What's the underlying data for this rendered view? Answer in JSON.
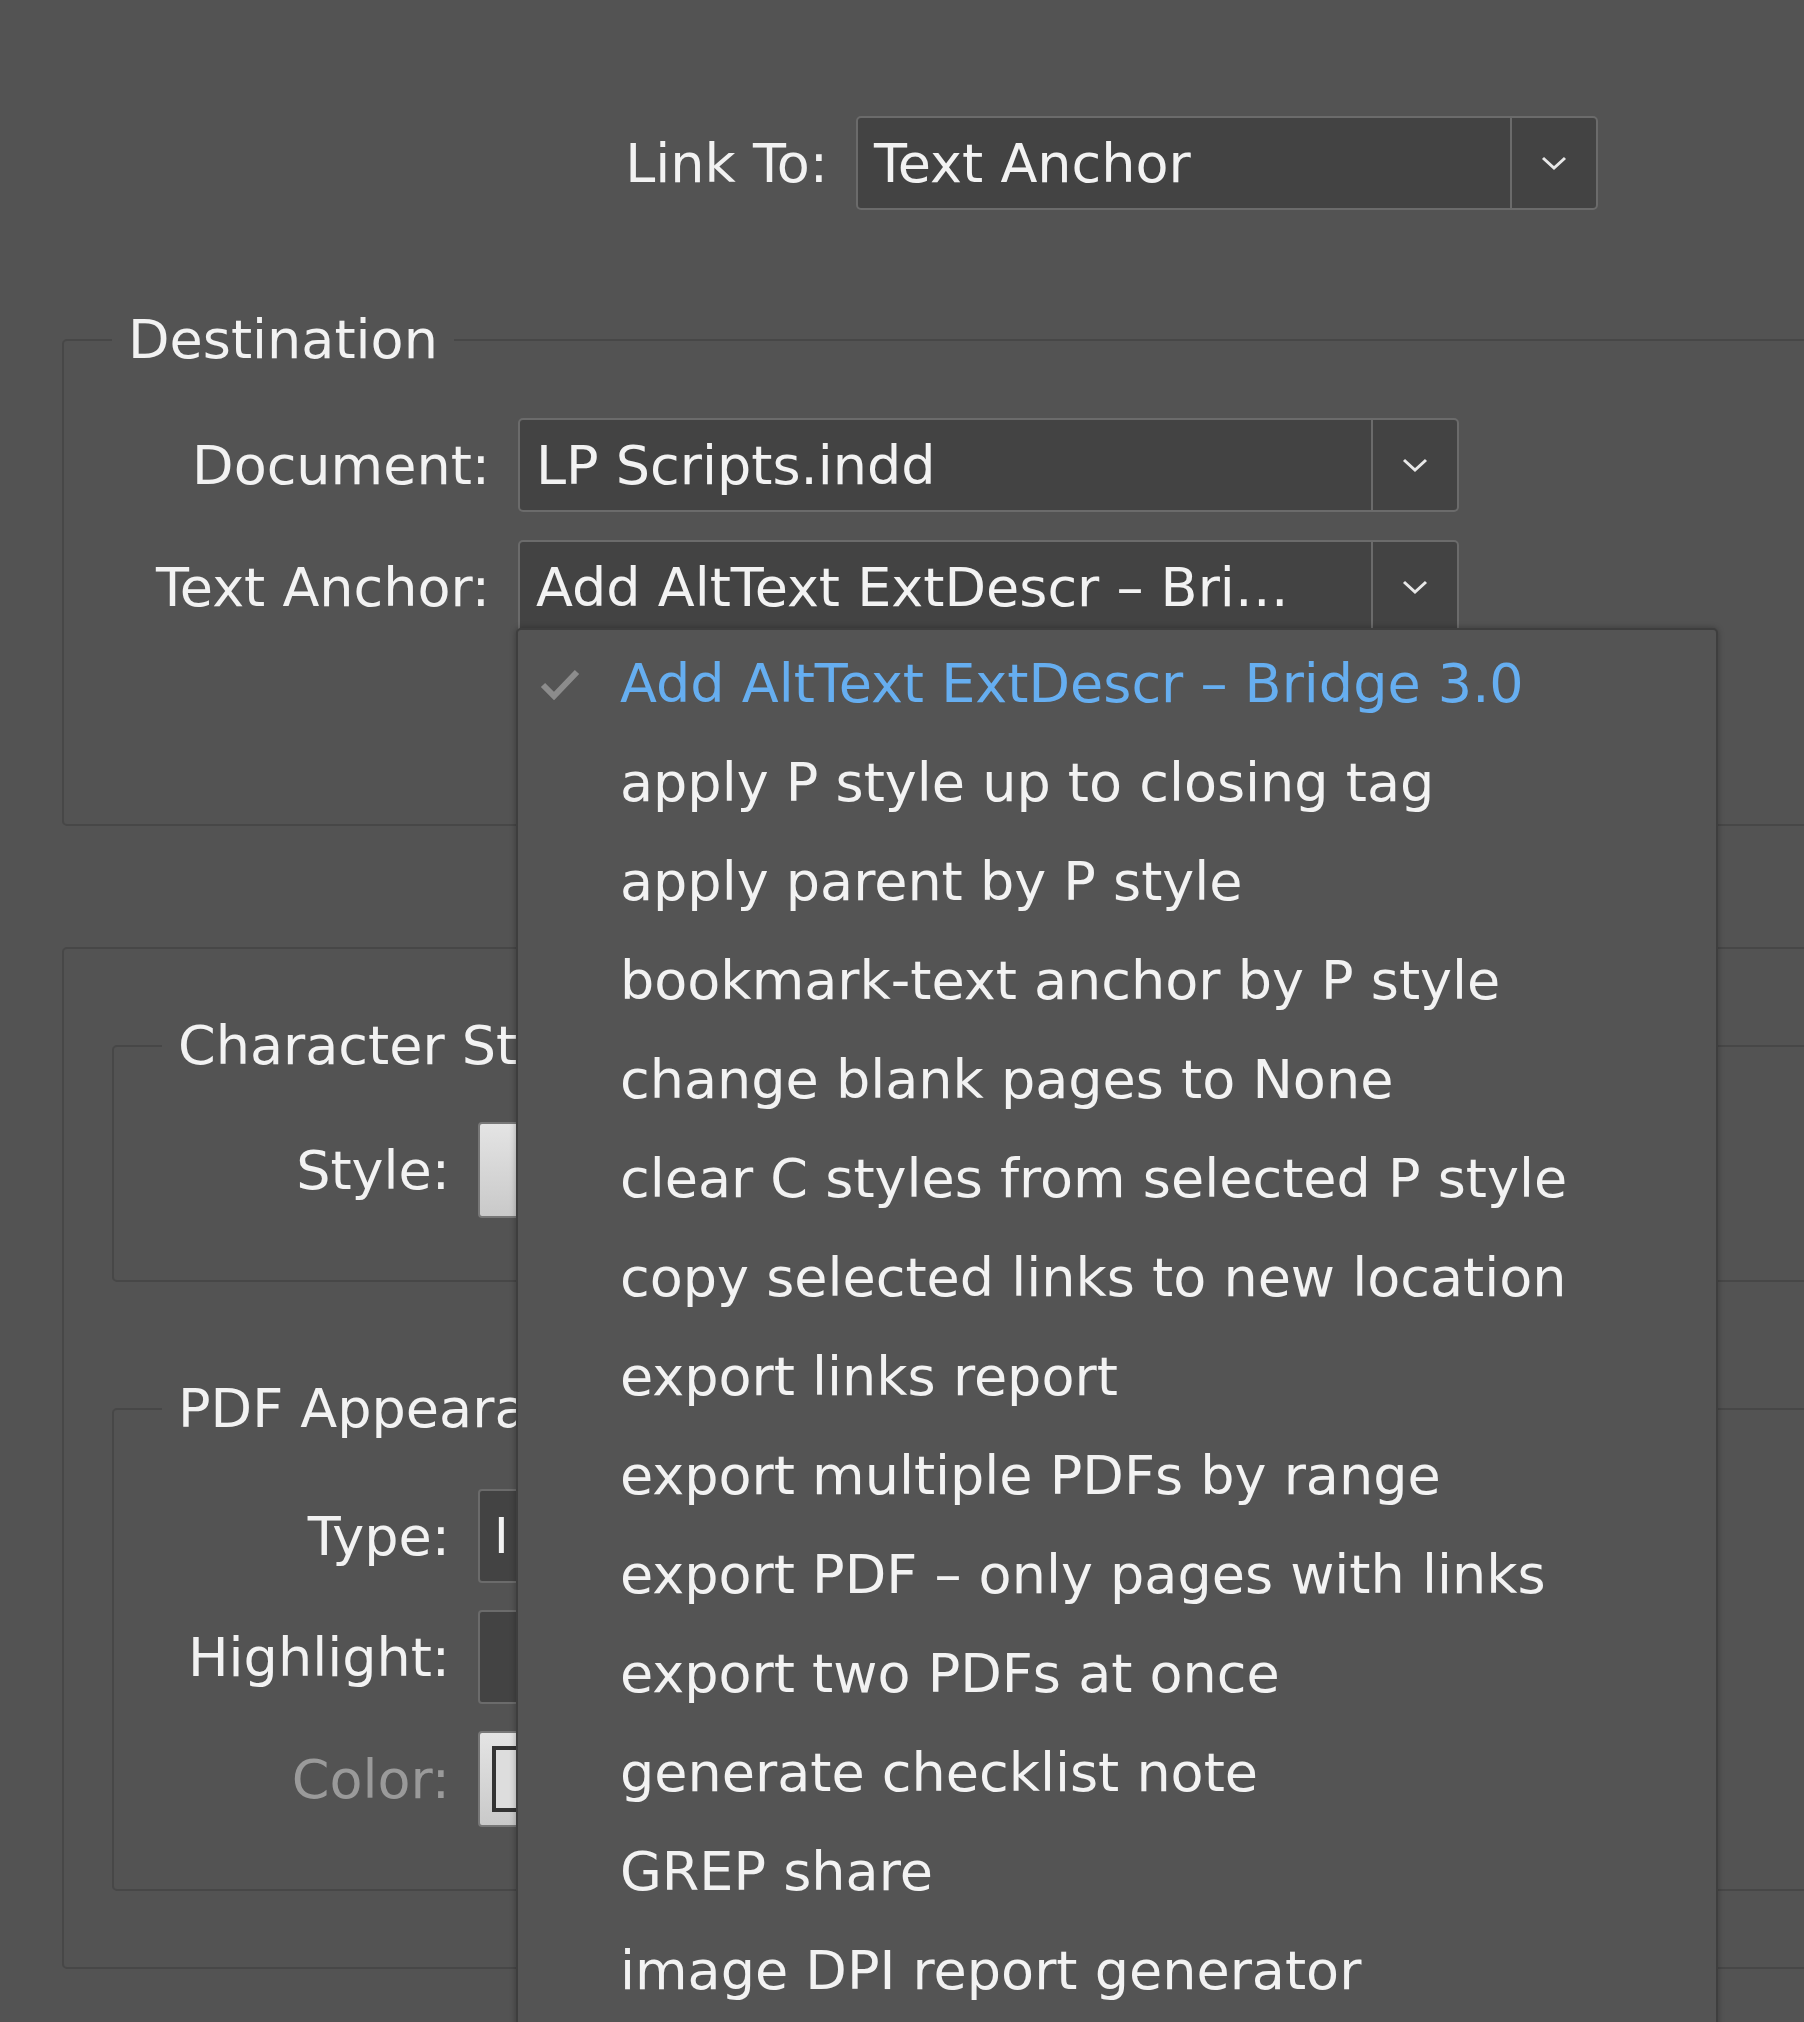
{
  "link_to": {
    "label": "Link To:",
    "value": "Text Anchor"
  },
  "destination": {
    "title": "Destination",
    "fields": [
      {
        "label": "Document:",
        "value": "LP Scripts.indd"
      },
      {
        "label": "Text Anchor:",
        "value": "Add AltText ExtDescr – Bri…"
      }
    ]
  },
  "character_style": {
    "title": "Character St",
    "style_label": "Style:"
  },
  "pdf_appearance": {
    "title": "PDF Appeara",
    "fields": [
      {
        "label": "Type:",
        "kind": "select",
        "value": "I",
        "disabled": false
      },
      {
        "label": "Highlight:",
        "kind": "select",
        "disabled": false
      },
      {
        "label": "Color:",
        "kind": "swatch",
        "disabled": true
      }
    ]
  },
  "menu": {
    "items": [
      {
        "label": "Add AltText ExtDescr – Bridge 3.0",
        "selected": true
      },
      {
        "label": "apply P style up to closing tag",
        "selected": false
      },
      {
        "label": "apply parent by P style",
        "selected": false
      },
      {
        "label": "bookmark-text anchor by P style",
        "selected": false
      },
      {
        "label": "change blank pages to None",
        "selected": false
      },
      {
        "label": "clear C styles from selected P style",
        "selected": false
      },
      {
        "label": "copy selected links to new location",
        "selected": false
      },
      {
        "label": "export links report",
        "selected": false
      },
      {
        "label": "export multiple PDFs by range",
        "selected": false
      },
      {
        "label": "export PDF – only pages with links",
        "selected": false
      },
      {
        "label": "export two PDFs at once",
        "selected": false
      },
      {
        "label": "generate checklist note",
        "selected": false
      },
      {
        "label": "GREP share",
        "selected": false
      },
      {
        "label": "image DPI report generator",
        "selected": false
      }
    ]
  }
}
